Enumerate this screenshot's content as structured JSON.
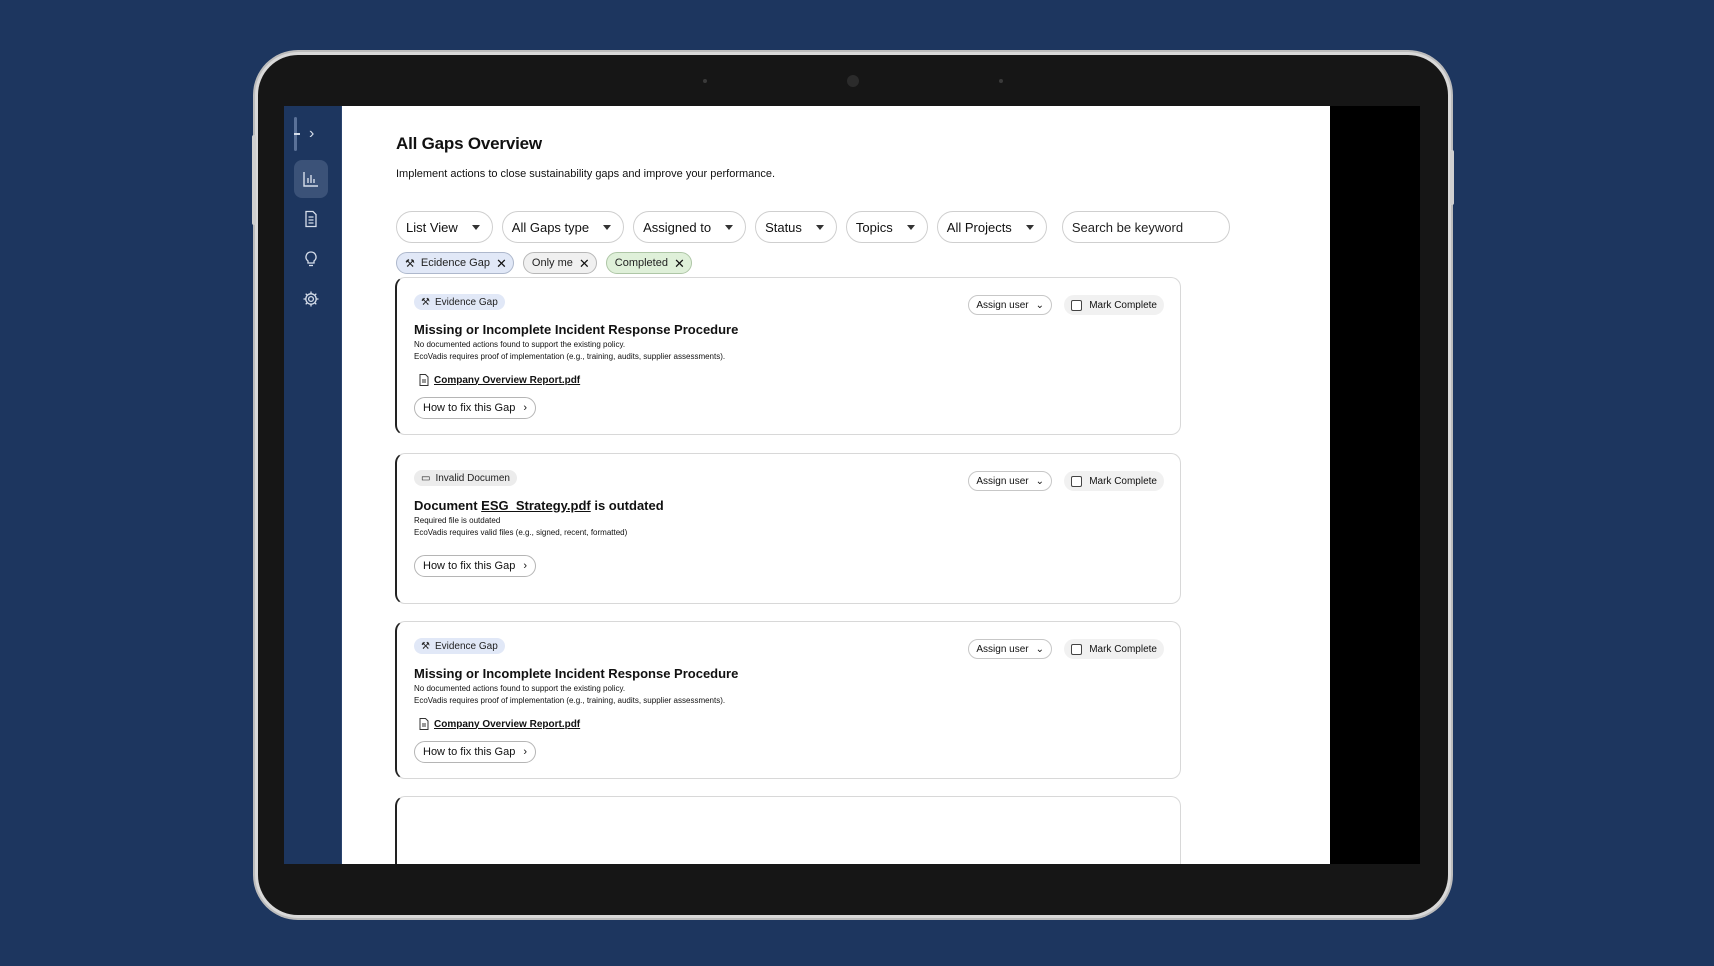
{
  "page": {
    "title": "All Gaps Overview",
    "subtitle": "Implement actions to close sustainability gaps and improve your performance."
  },
  "sidebar": {
    "toggle_icon": "chevron-right-icon",
    "items": [
      {
        "icon": "bar-chart-icon",
        "active": true
      },
      {
        "icon": "document-icon",
        "active": false
      },
      {
        "icon": "lightbulb-icon",
        "active": false
      },
      {
        "icon": "gear-icon",
        "active": false
      }
    ]
  },
  "filters": [
    {
      "label": "List View"
    },
    {
      "label": "All Gaps type"
    },
    {
      "label": "Assigned to"
    },
    {
      "label": "Status"
    },
    {
      "label": "Topics"
    },
    {
      "label": "All Projects"
    }
  ],
  "search": {
    "placeholder": "Search be keyword"
  },
  "active_chips": [
    {
      "label": "Ecidence Gap",
      "icon": "tools-icon"
    },
    {
      "label": "Only me"
    },
    {
      "label": "Completed"
    }
  ],
  "cards": [
    {
      "tag": "Evidence Gap",
      "tag_icon": "tools-icon",
      "title": "Missing or Incomplete Incident Response Procedure",
      "line1": "No documented actions found to support the existing policy.",
      "line2": "EcoVadis requires proof of implementation (e.g., training, audits, supplier assessments).",
      "attachment": "Company Overview Report.pdf",
      "fix_label": "How to fix this Gap",
      "assign_label": "Assign user",
      "mark_label": "Mark Complete"
    },
    {
      "tag": "Invalid Documen",
      "tag_icon": "comment-icon",
      "title_prefix": "Document ",
      "title_link": "ESG_Strategy.pdf",
      "title_suffix": " is outdated",
      "line1": "Required file is outdated",
      "line2": "EcoVadis requires valid files (e.g., signed, recent, formatted)",
      "fix_label": "How to fix this Gap",
      "assign_label": "Assign user",
      "mark_label": "Mark Complete"
    },
    {
      "tag": "Evidence Gap",
      "tag_icon": "tools-icon",
      "title": "Missing or Incomplete Incident Response Procedure",
      "line1": "No documented actions found to support the existing policy.",
      "line2": "EcoVadis requires proof of implementation (e.g., training, audits, supplier assessments).",
      "attachment": "Company Overview Report.pdf",
      "fix_label": "How to fix this Gap",
      "assign_label": "Assign user",
      "mark_label": "Mark Complete"
    }
  ],
  "colors": {
    "background": "#1d365f",
    "sidebar": "#1d365f",
    "chip_blue": "#e1e8f7",
    "chip_green": "#dff0d9"
  }
}
